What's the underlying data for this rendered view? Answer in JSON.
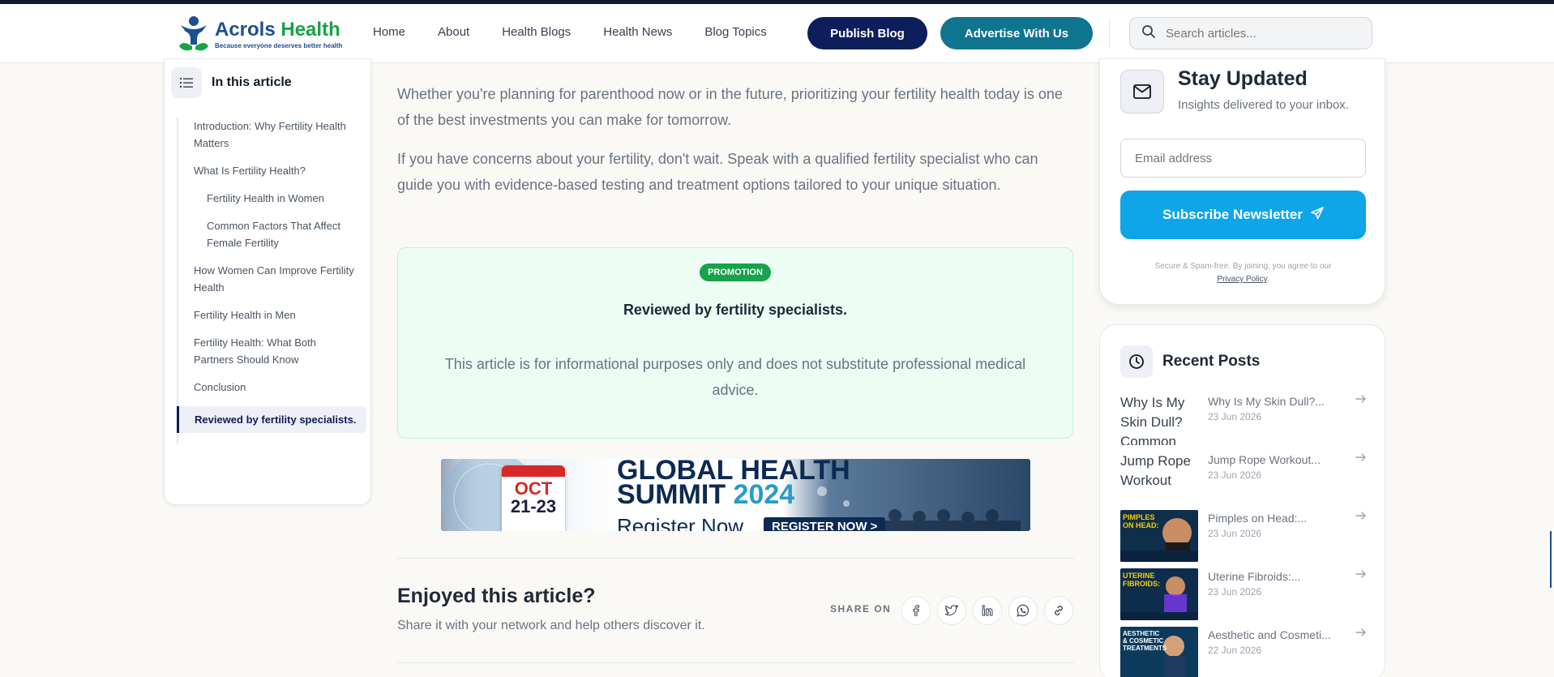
{
  "header": {
    "logo_title_main": "Acrols",
    "logo_title_accent": "Health",
    "logo_tagline": "Because everyone deserves better health",
    "nav": [
      "Home",
      "About",
      "Health Blogs",
      "Health News",
      "Blog Topics"
    ],
    "publish_label": "Publish Blog",
    "advertise_label": "Advertise With Us",
    "search_placeholder": "Search articles..."
  },
  "toc": {
    "title": "In this article",
    "items": [
      {
        "label": "Introduction: Why Fertility Health Matters",
        "level": 1
      },
      {
        "label": "What Is Fertility Health?",
        "level": 1
      },
      {
        "label": "Fertility Health in Women",
        "level": 2
      },
      {
        "label": "Common Factors That Affect Female Fertility",
        "level": 2
      },
      {
        "label": "How Women Can Improve Fertility Health",
        "level": 1
      },
      {
        "label": "Fertility Health in Men",
        "level": 1
      },
      {
        "label": "Fertility Health: What Both Partners Should Know",
        "level": 1
      },
      {
        "label": "Conclusion",
        "level": 1
      },
      {
        "label": "Reviewed by fertility specialists.",
        "level": 1,
        "active": true
      }
    ]
  },
  "article": {
    "para1": "Whether you're planning for parenthood now or in the future, prioritizing your fertility health today is one of the best investments you can make for tomorrow.",
    "para2": "If you have concerns about your fertility, don't wait. Speak with a qualified fertility specialist who can guide you with evidence-based testing and treatment options tailored to your unique situation.",
    "promo_badge": "PROMOTION",
    "promo_title": "Reviewed by fertility specialists.",
    "promo_text": "This article is for informational purposes only and does not substitute professional medical advice.",
    "banner": {
      "cal_top": "OCT",
      "cal_bottom": "21-23",
      "line1": "GLOBAL HEALTH",
      "line2": "SUMMIT",
      "year": "2024",
      "line3": "Register Now",
      "button": "REGISTER NOW >"
    },
    "enjoy_title": "Enjoyed this article?",
    "enjoy_sub": "Share it with your network and help others discover it.",
    "share_label": "SHARE ON",
    "share_icons": [
      "facebook-icon",
      "twitter-icon",
      "linkedin-icon",
      "whatsapp-icon",
      "link-icon"
    ]
  },
  "subscribe": {
    "title": "Stay Updated",
    "desc": "Insights delivered to your inbox.",
    "email_placeholder": "Email address",
    "button": "Subscribe Newsletter",
    "note": "Secure & Spam-free. By joining, you agree to our",
    "privacy": "Privacy Policy",
    "privacy_end": "."
  },
  "recent": {
    "title": "Recent Posts",
    "posts": [
      {
        "title": "Why Is My Skin Dull?...",
        "date": "23 Jun 2026",
        "alt": "Why Is My Skin Dull? Common",
        "image": false
      },
      {
        "title": "Jump Rope Workout...",
        "date": "23 Jun 2026",
        "alt": "Jump Rope Workout",
        "image": false
      },
      {
        "title": "Pimples on Head:...",
        "date": "23 Jun 2026",
        "thumb_text": "PIMPLES ON HEAD:",
        "image": true,
        "color": "#f5d000"
      },
      {
        "title": "Uterine Fibroids:...",
        "date": "23 Jun 2026",
        "thumb_text": "UTERINE FIBROIDS:",
        "image": true,
        "color": "#f5d000"
      },
      {
        "title": "Aesthetic and Cosmeti...",
        "date": "22 Jun 2026",
        "thumb_text": "AESTHETIC & COSMETIC TREATMENTS",
        "image": true,
        "color": "#ffffff"
      }
    ]
  },
  "colors": {
    "brand_navy": "#0c1e5b",
    "brand_teal": "#0e7490",
    "subscribe_blue": "#0ea5e9",
    "promo_green": "#16a34a"
  }
}
